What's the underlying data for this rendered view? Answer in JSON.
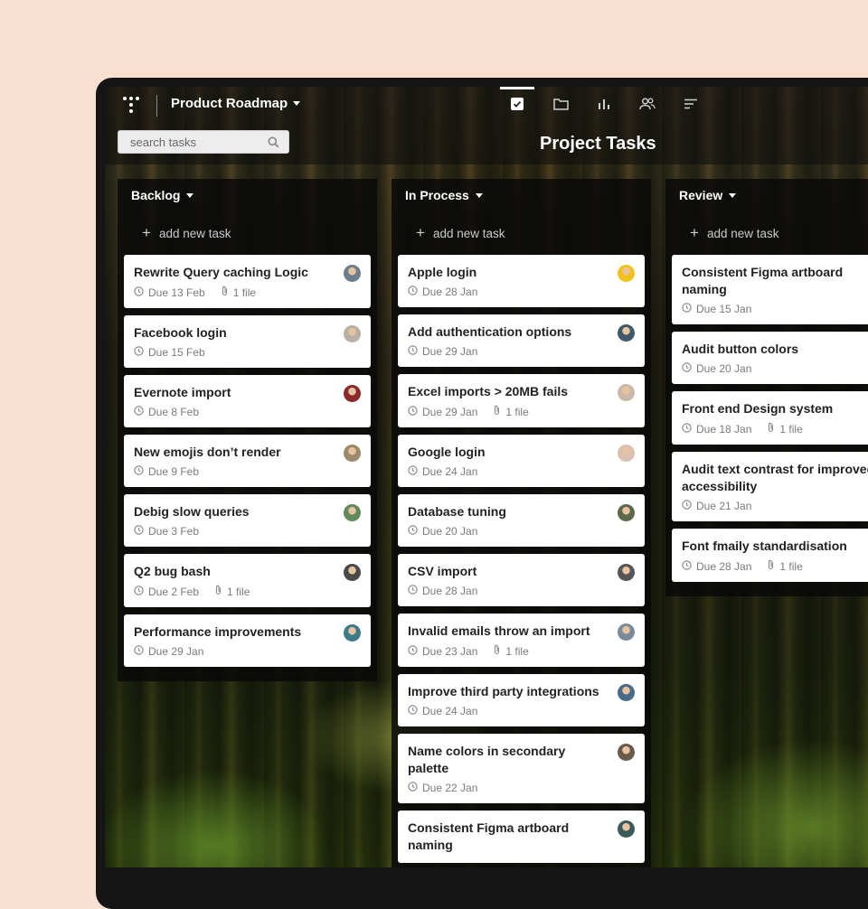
{
  "header": {
    "project_name": "Product Roadmap",
    "page_title": "Project Tasks",
    "search_placeholder": "search tasks",
    "nav": [
      "tasks-icon",
      "folder-icon",
      "chart-icon",
      "team-icon",
      "sort-icon"
    ],
    "active_nav": "tasks-icon"
  },
  "add_task_label": "add new task",
  "columns": [
    {
      "title": "Backlog",
      "cards": [
        {
          "title": "Rewrite Query caching Logic",
          "due": "Due 13 Feb",
          "files": "1 file",
          "avatar": "#6b7f8e"
        },
        {
          "title": "Facebook login",
          "due": "Due 15 Feb",
          "files": "",
          "avatar": "#b7b0a5"
        },
        {
          "title": "Evernote import",
          "due": "Due 8 Feb",
          "files": "",
          "avatar": "#8b2a2a"
        },
        {
          "title": "New emojis don’t render",
          "due": "Due 9 Feb",
          "files": "",
          "avatar": "#9a8a6a"
        },
        {
          "title": "Debig slow queries",
          "due": "Due 3 Feb",
          "files": "",
          "avatar": "#5f8a5a"
        },
        {
          "title": "Q2 bug bash",
          "due": "Due 2 Feb",
          "files": "1 file",
          "avatar": "#4a4a4a"
        },
        {
          "title": "Performance improvements",
          "due": "Due 29 Jan",
          "files": "",
          "avatar": "#3d7a8a"
        }
      ]
    },
    {
      "title": "In Process",
      "cards": [
        {
          "title": "Apple login",
          "due": "Due 28 Jan",
          "files": "",
          "avatar": "#f2c21a"
        },
        {
          "title": "Add authentication options",
          "due": "Due 29 Jan",
          "files": "",
          "avatar": "#3f5a6a"
        },
        {
          "title": "Excel imports > 20MB fails",
          "due": "Due 29 Jan",
          "files": "1 file",
          "avatar": "#c9b8a8"
        },
        {
          "title": "Google login",
          "due": "Due 24 Jan",
          "files": "",
          "avatar": "#d9c0b0"
        },
        {
          "title": "Database tuning",
          "due": "Due 20 Jan",
          "files": "",
          "avatar": "#5a6a4a"
        },
        {
          "title": "CSV import",
          "due": "Due 28 Jan",
          "files": "",
          "avatar": "#555555"
        },
        {
          "title": "Invalid emails throw an import",
          "due": "Due 23 Jan",
          "files": "1 file",
          "avatar": "#7a8a9a"
        },
        {
          "title": "Improve third party integrations",
          "due": "Due 24 Jan",
          "files": "",
          "avatar": "#4a6a8a"
        },
        {
          "title": "Name colors in secondary palette",
          "due": "Due 22 Jan",
          "files": "",
          "avatar": "#6a5a4a"
        },
        {
          "title": "Consistent Figma artboard naming",
          "due": "",
          "files": "",
          "avatar": "#3a5a5a"
        }
      ]
    },
    {
      "title": "Review",
      "cards": [
        {
          "title": "Consistent Figma artboard naming",
          "due": "Due 15 Jan",
          "files": ""
        },
        {
          "title": "Audit button colors",
          "due": "Due 20 Jan",
          "files": ""
        },
        {
          "title": "Front end Design system",
          "due": "Due 18 Jan",
          "files": "1 file"
        },
        {
          "title": "Audit text contrast for improved accessibility",
          "due": "Due 21 Jan",
          "files": ""
        },
        {
          "title": "Font fmaily standardisation",
          "due": "Due 28 Jan",
          "files": "1 file"
        }
      ]
    }
  ]
}
